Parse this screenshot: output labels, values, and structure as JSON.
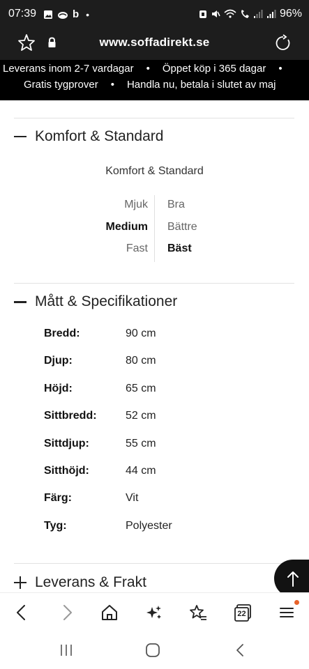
{
  "status_bar": {
    "time": "07:39",
    "carrier_b": "b",
    "dot": "•",
    "battery": "96%"
  },
  "url_bar": {
    "url": "www.soffadirekt.se"
  },
  "promo": {
    "line1": [
      "Leverans inom 2-7 vardagar",
      "Öppet köp i 365 dagar"
    ],
    "line2": [
      "Gratis tygprover",
      "Handla nu, betala i slutet av maj"
    ],
    "separator": "•"
  },
  "komfort": {
    "title": "Komfort & Standard",
    "subtitle": "Komfort & Standard",
    "left": [
      "Mjuk",
      "Medium",
      "Fast"
    ],
    "right": [
      "Bra",
      "Bättre",
      "Bäst"
    ],
    "selected_left": "Medium",
    "selected_right": "Bäst"
  },
  "specs": {
    "title": "Mått & Specifikationer",
    "rows": [
      {
        "label": "Bredd:",
        "value": "90 cm"
      },
      {
        "label": "Djup:",
        "value": "80 cm"
      },
      {
        "label": "Höjd:",
        "value": "65 cm"
      },
      {
        "label": "Sittbredd:",
        "value": "52 cm"
      },
      {
        "label": "Sittdjup:",
        "value": "55 cm"
      },
      {
        "label": "Sitthöjd:",
        "value": "44 cm"
      },
      {
        "label": "Färg:",
        "value": "Vit"
      },
      {
        "label": "Tyg:",
        "value": "Polyester"
      }
    ]
  },
  "leverans": {
    "title": "Leverans & Frakt"
  },
  "browser_toolbar": {
    "tab_count": "22",
    "icons": [
      "back-arrow-icon",
      "forward-arrow-icon",
      "home-icon",
      "sparkle-icon",
      "bookmark-star-icon",
      "tabs-icon",
      "menu-icon"
    ],
    "menu_badge_color": "#e8632a"
  },
  "colors": {
    "status_bg": "#1d1d1d",
    "banner_bg": "#000000",
    "text_primary": "#222222"
  }
}
